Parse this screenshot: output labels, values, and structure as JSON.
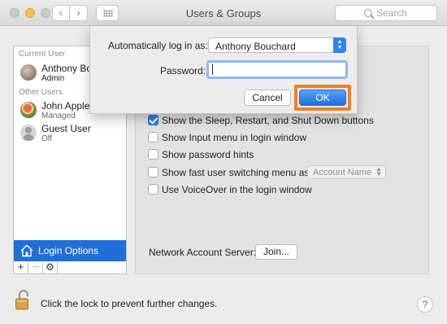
{
  "window": {
    "title": "Users & Groups",
    "search_placeholder": "Search"
  },
  "sidebar": {
    "current_user_header": "Current User",
    "other_users_header": "Other Users",
    "users": [
      {
        "name": "Anthony Bouchard",
        "role": "Admin"
      },
      {
        "name": "John Applesee",
        "role": "Managed"
      },
      {
        "name": "Guest User",
        "role": "Off"
      }
    ],
    "login_options_label": "Login Options",
    "add_label": "+",
    "remove_label": "−",
    "gear_label": "⚙"
  },
  "options": {
    "show_sleep_label": "Show the Sleep, Restart, and Shut Down buttons",
    "show_sleep_checked": true,
    "show_input_menu_label": "Show Input menu in login window",
    "show_password_hints_label": "Show password hints",
    "fast_user_switching_label": "Show fast user switching menu as",
    "fast_user_switching_value": "Account Name",
    "voiceover_label": "Use VoiceOver in the login window"
  },
  "network": {
    "label": "Network Account Server:",
    "join_label": "Join..."
  },
  "footer": {
    "lock_text": "Click the lock to prevent further changes.",
    "help_label": "?"
  },
  "sheet": {
    "auto_login_label": "Automatically log in as:",
    "auto_login_value": "Anthony Bouchard",
    "password_label": "Password:",
    "password_value": "",
    "cancel_label": "Cancel",
    "ok_label": "OK"
  },
  "colors": {
    "accent": "#1f6fd6",
    "highlight": "#f47e22"
  }
}
